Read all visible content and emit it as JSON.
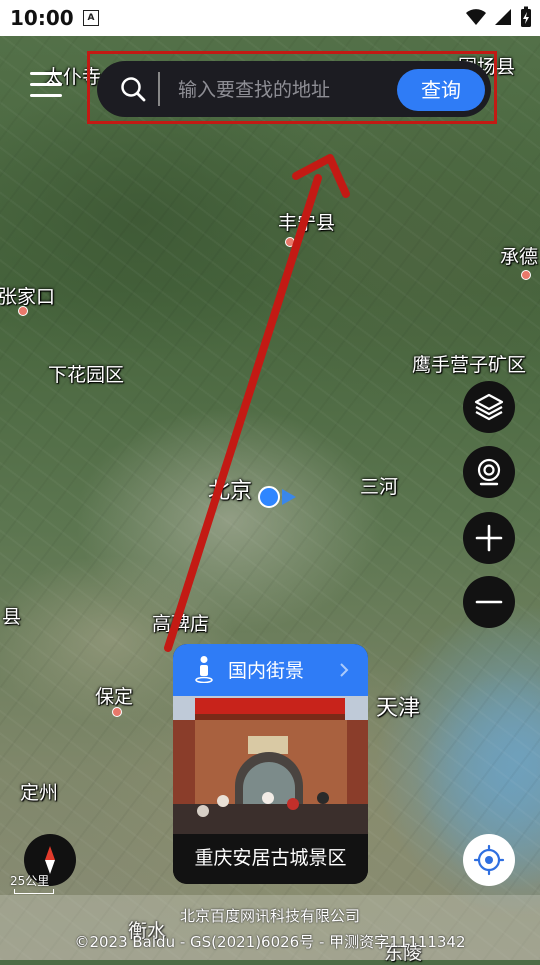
{
  "status_bar": {
    "time": "10:00",
    "notification_icon": "A"
  },
  "search": {
    "placeholder": "输入要查找的地址",
    "button_label": "查询"
  },
  "map_labels": {
    "taipusi": "太仆寺",
    "weichang": "围场县",
    "fengning": "丰宁县",
    "chengde": "承德",
    "zhangjiakou": "张家口",
    "xiahuayuan": "下花园区",
    "yingshouyingzi": "鹰手营子矿区",
    "beijing": "北京",
    "sanhe": "三河",
    "county_left": "县",
    "gaobeidian": "高碑店",
    "baoding": "保定",
    "tianjin": "天津",
    "dingzhou": "定州",
    "hengshui": "衡水",
    "dongling": "东陵"
  },
  "street_view": {
    "title": "国内街景",
    "caption": "重庆安居古城景区",
    "accent_color": "#2f7cf6"
  },
  "controls": {
    "layers_icon": "layers-icon",
    "streetview_icon": "camera-icon",
    "zoom_in_icon": "plus-icon",
    "zoom_out_icon": "minus-icon",
    "compass_icon": "compass-icon",
    "locate_icon": "locate-icon"
  },
  "scale": {
    "label": "25公里"
  },
  "footer": {
    "line1": "北京百度网讯科技有限公司",
    "line2": "©2023 Baidu - GS(2021)6026号 - 甲测资字11111342"
  },
  "annotation": {
    "frame_color": "#c31a14",
    "arrow_color": "#c31a14"
  }
}
